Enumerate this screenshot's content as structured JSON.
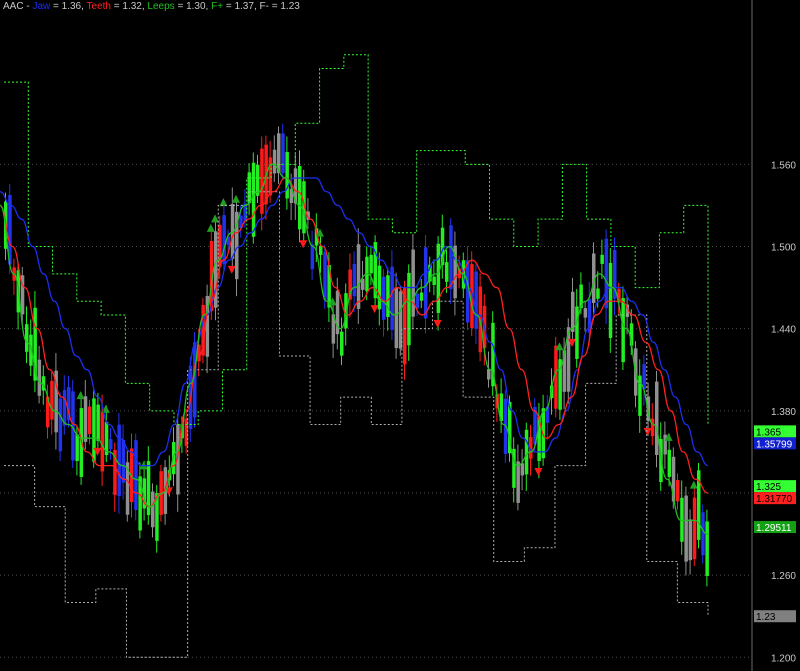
{
  "title_bar": {
    "symbol": "AAC",
    "sep": " - ",
    "items": [
      {
        "label": "Jaw",
        "value": "= 1.36",
        "color": "#1c2ff0"
      },
      {
        "label": "Teeth",
        "value": "= 1.32",
        "color": "#ff2020"
      },
      {
        "label": "Leeps",
        "value": "= 1.30",
        "color": "#20c020"
      },
      {
        "label": "F+",
        "value": "= 1.37",
        "color": "#20c020"
      },
      {
        "label": "F-",
        "value": "= 1.23",
        "color": "#c8c8c8"
      }
    ]
  },
  "axis_labels": [
    "1.560",
    "1.500",
    "1.440",
    "1.380",
    "1.320",
    "1.260",
    "1.200"
  ],
  "price_tags": [
    {
      "label": "1.365",
      "value": 1.365,
      "bg": "#33ff33",
      "fg": "#000000"
    },
    {
      "label": "1.35799",
      "value": 1.35799,
      "bg": "#1020d0",
      "fg": "#ffffff"
    },
    {
      "label": "1.325",
      "value": 1.325,
      "bg": "#33ff33",
      "fg": "#000000"
    },
    {
      "label": "1.31770",
      "value": 1.3177,
      "bg": "#ff2020",
      "fg": "#000000"
    },
    {
      "label": "1.29511",
      "value": 1.29511,
      "bg": "#14a014",
      "fg": "#ffffff"
    },
    {
      "label": "1.23",
      "value": 1.23,
      "bg": "#808080",
      "fg": "#000000"
    }
  ],
  "colors": {
    "background": "#000000",
    "grid": "#4a4a4a",
    "jaw": "#1c2ff0",
    "teeth": "#ff2020",
    "lips": "#20c020",
    "fractal_up": "#33ff33",
    "fractal_down": "#b0b0b0",
    "bar_up": "#22ee22",
    "bar_down": "#ff1a1a",
    "bar_neutral_up": "#2233ee",
    "bar_neutral_down": "#909090"
  },
  "chart_data": {
    "type": "line",
    "ylim": [
      1.19,
      1.68
    ],
    "ytick_values": [
      1.56,
      1.5,
      1.44,
      1.38,
      1.32,
      1.26,
      1.2
    ],
    "grid": true,
    "grid_style": "dotted",
    "series": [
      {
        "name": "Jaw",
        "color": "#1c2ff0",
        "values": [
          1.54,
          1.53,
          1.52,
          1.5,
          1.48,
          1.46,
          1.44,
          1.42,
          1.41,
          1.39,
          1.37,
          1.36,
          1.35,
          1.34,
          1.34,
          1.35,
          1.37,
          1.4,
          1.43,
          1.45,
          1.47,
          1.49,
          1.5,
          1.51,
          1.52,
          1.53,
          1.54,
          1.55,
          1.55,
          1.55,
          1.54,
          1.53,
          1.52,
          1.51,
          1.5,
          1.49,
          1.48,
          1.47,
          1.47,
          1.48,
          1.49,
          1.5,
          1.49,
          1.47,
          1.45,
          1.43,
          1.41,
          1.38,
          1.36,
          1.35,
          1.35,
          1.36,
          1.38,
          1.41,
          1.44,
          1.46,
          1.47,
          1.47,
          1.46,
          1.45,
          1.43,
          1.41,
          1.39,
          1.37,
          1.35,
          1.34
        ]
      },
      {
        "name": "Teeth",
        "color": "#ff2020",
        "values": [
          1.53,
          1.5,
          1.47,
          1.44,
          1.41,
          1.39,
          1.37,
          1.35,
          1.34,
          1.34,
          1.33,
          1.32,
          1.31,
          1.32,
          1.34,
          1.38,
          1.42,
          1.46,
          1.49,
          1.51,
          1.52,
          1.53,
          1.54,
          1.55,
          1.54,
          1.52,
          1.5,
          1.47,
          1.45,
          1.46,
          1.47,
          1.46,
          1.47,
          1.46,
          1.45,
          1.46,
          1.47,
          1.48,
          1.49,
          1.48,
          1.47,
          1.44,
          1.41,
          1.38,
          1.36,
          1.37,
          1.39,
          1.42,
          1.45,
          1.46,
          1.46,
          1.45,
          1.43,
          1.41,
          1.38,
          1.35,
          1.33,
          1.32
        ]
      },
      {
        "name": "Leeps",
        "color": "#20c020",
        "values": [
          1.53,
          1.48,
          1.43,
          1.4,
          1.38,
          1.37,
          1.36,
          1.36,
          1.35,
          1.34,
          1.33,
          1.31,
          1.32,
          1.35,
          1.4,
          1.45,
          1.49,
          1.51,
          1.53,
          1.54,
          1.56,
          1.55,
          1.53,
          1.5,
          1.46,
          1.44,
          1.47,
          1.48,
          1.46,
          1.45,
          1.46,
          1.47,
          1.48,
          1.5,
          1.48,
          1.45,
          1.41,
          1.37,
          1.34,
          1.35,
          1.38,
          1.41,
          1.44,
          1.46,
          1.48,
          1.47,
          1.44,
          1.4,
          1.37,
          1.33,
          1.3,
          1.3,
          1.29
        ]
      },
      {
        "name": "F+",
        "color": "#33ff33",
        "values": [
          1.62,
          1.5,
          1.48,
          1.46,
          1.45,
          1.4,
          1.38,
          1.37,
          1.38,
          1.41,
          1.55,
          1.56,
          1.59,
          1.63,
          1.64,
          1.52,
          1.51,
          1.57,
          1.57,
          1.56,
          1.52,
          1.5,
          1.52,
          1.56,
          1.52,
          1.5,
          1.47,
          1.51,
          1.53,
          1.37
        ]
      },
      {
        "name": "F-",
        "color": "#b0b0b0",
        "values": [
          1.34,
          1.31,
          1.24,
          1.25,
          1.2,
          1.2,
          1.41,
          1.53,
          1.54,
          1.42,
          1.37,
          1.39,
          1.37,
          1.44,
          1.46,
          1.39,
          1.27,
          1.28,
          1.34,
          1.4,
          1.45,
          1.27,
          1.24,
          1.23
        ]
      }
    ]
  }
}
